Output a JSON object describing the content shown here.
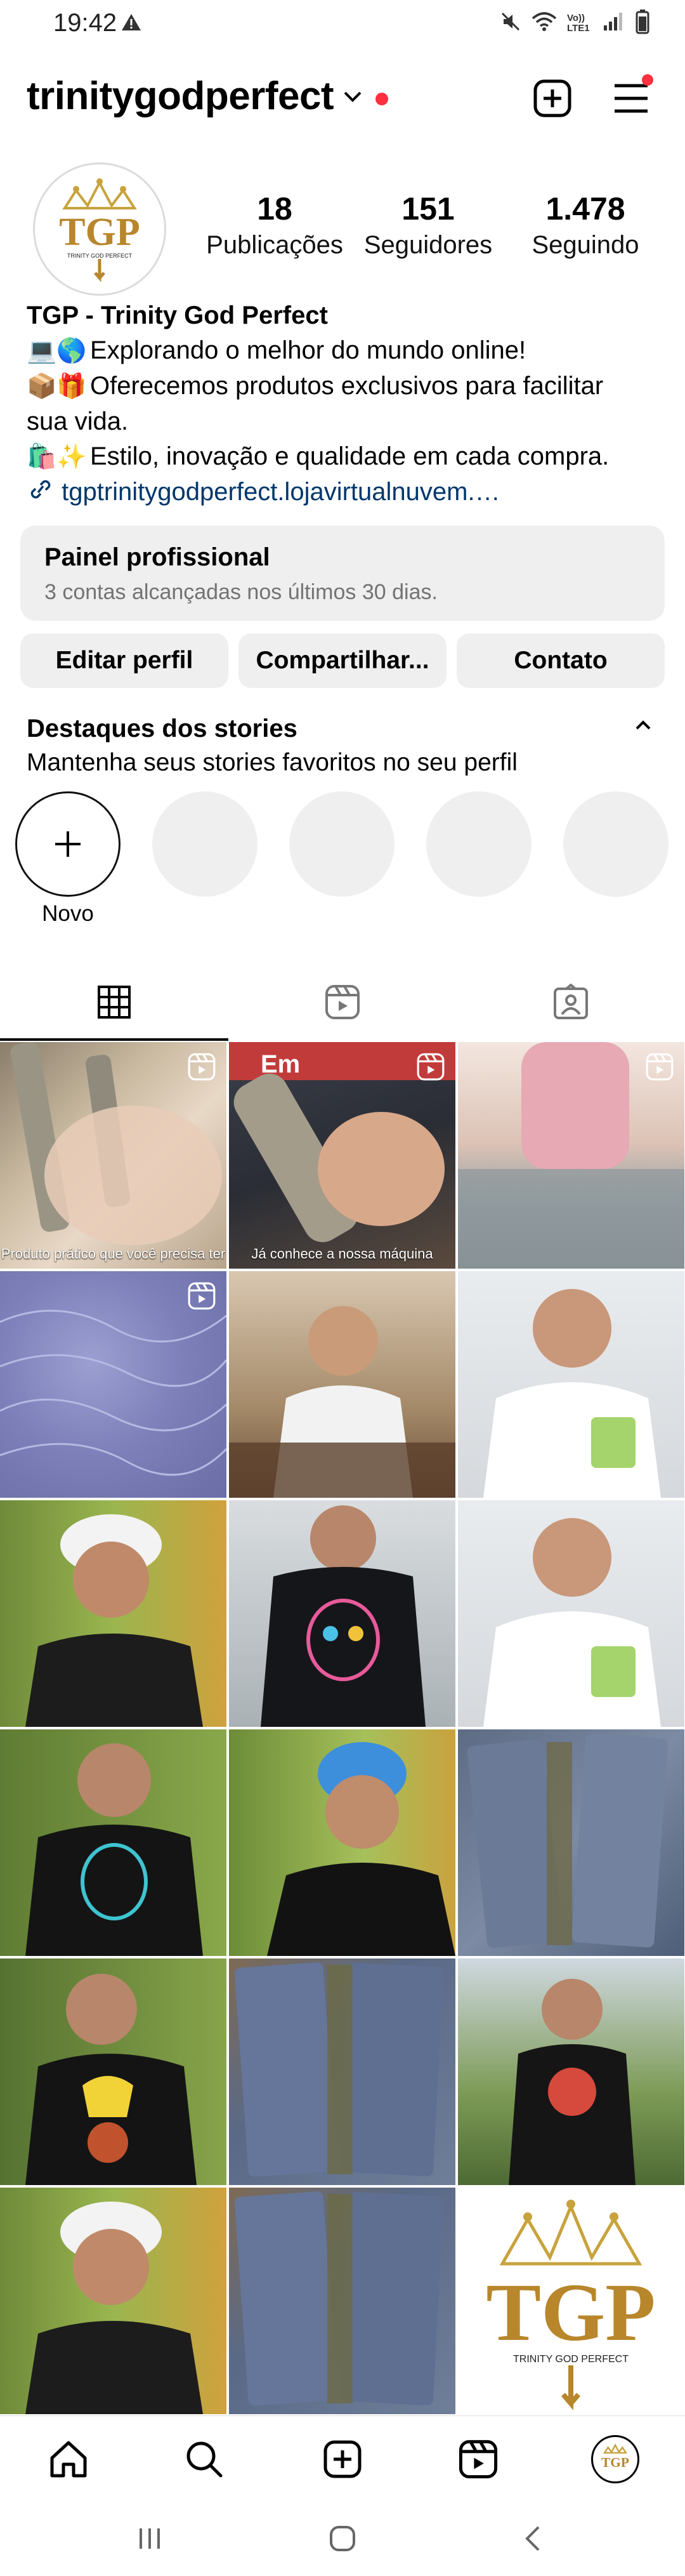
{
  "status_bar": {
    "time": "19:42",
    "network": "Vo)) LTE1",
    "icons": [
      "warning-icon",
      "mute-icon",
      "wifi-icon",
      "signal-icon",
      "battery-icon"
    ]
  },
  "header": {
    "username": "trinitygodperfect",
    "icons": [
      "chevron-down-icon",
      "new-post-icon",
      "menu-icon"
    ],
    "notification_color": "#ff3040"
  },
  "profile": {
    "avatar_logo": "TGP",
    "avatar_subtitle": "TRINITY GOD PERFECT",
    "stats": [
      {
        "value": "18",
        "label": "Publicações"
      },
      {
        "value": "151",
        "label": "Seguidores"
      },
      {
        "value": "1.478",
        "label": "Seguindo"
      }
    ],
    "bio": {
      "name": "TGP - Trinity God Perfect",
      "line1_emoji": "💻🌎",
      "line1": "Explorando o melhor do mundo online!",
      "line2_emoji": "📦🎁",
      "line2": "Oferecemos produtos exclusivos para facilitar",
      "line2b": "sua vida.",
      "line3_emoji": "🛍️✨",
      "line3": "Estilo, inovação e qualidade em cada compra.",
      "link": "tgptrinitygodperfect.lojavirtualnuvem.…"
    }
  },
  "dashboard": {
    "title": "Painel profissional",
    "subtitle": "3 contas alcançadas nos últimos 30 dias."
  },
  "buttons": {
    "edit": "Editar perfil",
    "share": "Compartilhar...",
    "contact": "Contato"
  },
  "highlights": {
    "title": "Destaques dos stories",
    "subtitle": "Mantenha seus stories favoritos no seu perfil",
    "new_label": "Novo"
  },
  "tabs": [
    "grid-icon",
    "reels-icon",
    "tagged-icon"
  ],
  "grid": {
    "captions": {
      "cell1": "Produto prático que você precisa ter",
      "cell2": "Já conhece a nossa máquina",
      "cell2_top": "Em"
    }
  },
  "colors": {
    "accent_link": "#00376b",
    "button_bg": "#efefef",
    "muted": "#737373",
    "brand_gold": "#b8862b"
  },
  "bottom_nav": [
    "home-icon",
    "search-icon",
    "create-icon",
    "reels-icon",
    "profile-avatar"
  ]
}
